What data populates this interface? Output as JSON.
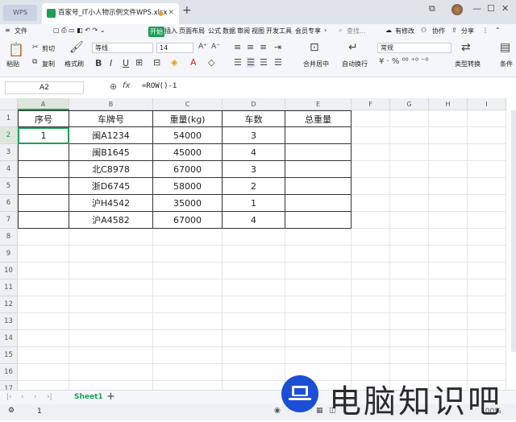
{
  "tabbar": {
    "home_tab": "WPS",
    "doc_tab": "百家号_IT小人物示例文件WPS.xlsx"
  },
  "menubar": {
    "file": "文件",
    "start": "开始",
    "insert": "插入",
    "layout": "页面布局",
    "formula": "公式",
    "data": "数据",
    "review": "审阅",
    "view": "视图",
    "dev": "开发工具",
    "member": "会员专享",
    "search": "查找...",
    "modify": "有修改",
    "collab": "协作",
    "share": "分享"
  },
  "ribbon": {
    "paste": "粘贴",
    "cut": "剪切",
    "copy": "复制",
    "format_painter": "格式刷",
    "font": "等线",
    "font_size": "14",
    "bold": "B",
    "italic": "I",
    "underline": "U",
    "merge": "合并居中",
    "wrap": "自动换行",
    "number_format": "常规",
    "convert": "类型转换",
    "cond": "条件"
  },
  "formula_bar": {
    "cell_ref": "A2",
    "fx": "fx",
    "formula": "=ROW()-1"
  },
  "columns": [
    "A",
    "B",
    "C",
    "D",
    "E",
    "F",
    "G",
    "H",
    "I"
  ],
  "rows": [
    "1",
    "2",
    "3",
    "4",
    "5",
    "6",
    "7",
    "8",
    "9",
    "10",
    "11",
    "12",
    "13",
    "14",
    "15",
    "16",
    "17"
  ],
  "table": {
    "headers": [
      "序号",
      "车牌号",
      "重量(kg)",
      "车数",
      "总重量"
    ],
    "data": [
      [
        "1",
        "闽A1234",
        "54000",
        "3",
        ""
      ],
      [
        "",
        "闽B1645",
        "45000",
        "4",
        ""
      ],
      [
        "",
        "北C8978",
        "67000",
        "3",
        ""
      ],
      [
        "",
        "浙D6745",
        "58000",
        "2",
        ""
      ],
      [
        "",
        "沪H4542",
        "35000",
        "1",
        ""
      ],
      [
        "",
        "沪A4582",
        "67000",
        "4",
        ""
      ]
    ]
  },
  "sheet": {
    "name": "Sheet1"
  },
  "status": {
    "value": "1",
    "zoom": "100%"
  },
  "watermark": {
    "text": "电脑知识吧"
  },
  "colors": {
    "accent": "#1f9e58",
    "selection": "#1f9e58",
    "logo": "#1a4fd6"
  }
}
